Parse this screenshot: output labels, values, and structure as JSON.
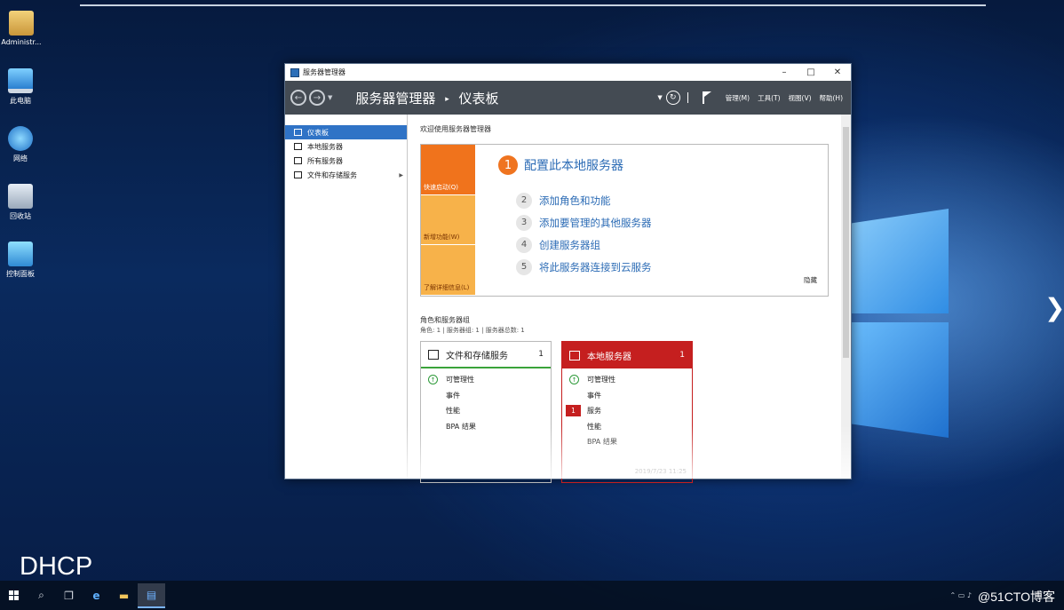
{
  "desktop": {
    "icons": [
      {
        "label": "Administr...",
        "icon": "user-folder-icon"
      },
      {
        "label": "此电脑",
        "icon": "computer-icon"
      },
      {
        "label": "网络",
        "icon": "network-icon"
      },
      {
        "label": "回收站",
        "icon": "recycle-bin-icon"
      },
      {
        "label": "控制面板",
        "icon": "control-panel-icon"
      }
    ],
    "overlay_label": "DHCP",
    "watermark": "@51CTO博客"
  },
  "window": {
    "title": "服务器管理器",
    "controls": {
      "minimize": "–",
      "maximize": "□",
      "close": "✕"
    },
    "breadcrumb": {
      "root": "服务器管理器",
      "separator": "▸",
      "current": "仪表板"
    },
    "menu": [
      "管理(M)",
      "工具(T)",
      "视图(V)",
      "帮助(H)"
    ]
  },
  "sidebar": {
    "items": [
      {
        "label": "仪表板",
        "active": true
      },
      {
        "label": "本地服务器",
        "active": false
      },
      {
        "label": "所有服务器",
        "active": false
      },
      {
        "label": "文件和存储服务",
        "active": false,
        "chevron": "▶"
      }
    ]
  },
  "welcome": {
    "title": "欢迎使用服务器管理器",
    "tiles": [
      "快速启动(Q)",
      "新增功能(W)",
      "了解详细信息(L)"
    ],
    "main_step": {
      "num": "1",
      "label": "配置此本地服务器"
    },
    "steps": [
      {
        "num": "2",
        "label": "添加角色和功能"
      },
      {
        "num": "3",
        "label": "添加要管理的其他服务器"
      },
      {
        "num": "4",
        "label": "创建服务器组"
      },
      {
        "num": "5",
        "label": "将此服务器连接到云服务"
      }
    ],
    "hide": "隐藏"
  },
  "roles": {
    "title": "角色和服务器组",
    "subtitle": "角色: 1 | 服务器组: 1 | 服务器总数: 1",
    "cards": [
      {
        "title": "文件和存储服务",
        "count": "1",
        "rows": [
          "可管理性",
          "事件",
          "性能",
          "BPA 结果"
        ]
      },
      {
        "title": "本地服务器",
        "count": "1",
        "rows": [
          "可管理性",
          "事件",
          "服务",
          "性能",
          "BPA 结果"
        ],
        "badge": "1",
        "timestamp": "2019/7/23 11:25"
      }
    ]
  },
  "colors": {
    "accent_blue": "#2f73c6",
    "tile_orange": "#f0731c",
    "tile_light": "#f7b24a",
    "alert_red": "#c51f1f",
    "ok_green": "#2e9a3a"
  }
}
